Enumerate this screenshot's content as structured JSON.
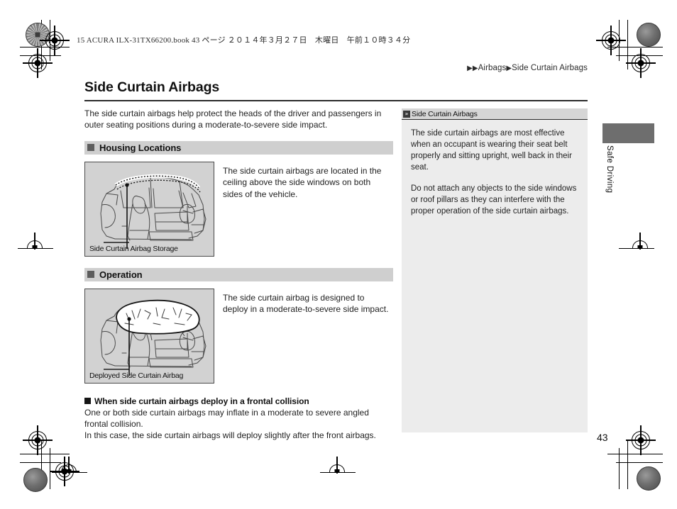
{
  "print_header": "15 ACURA ILX-31TX66200.book  43 ページ  ２０１４年３月２７日　木曜日　午前１０時３４分",
  "breadcrumb": {
    "arrow1": "▶",
    "arrow2": "▶",
    "parent": "Airbags",
    "arrow3": "▶",
    "current": "Side Curtain Airbags"
  },
  "page": {
    "title": "Side Curtain Airbags",
    "intro": "The side curtain airbags help protect the heads of the driver and passengers in outer seating positions during a moderate-to-severe side impact.",
    "number": "43"
  },
  "sections": [
    {
      "heading": "Housing Locations",
      "figure_caption": "Side Curtain Airbag Storage",
      "body": "The side curtain airbags are located in the ceiling above the side windows on both sides of the vehicle."
    },
    {
      "heading": "Operation",
      "figure_caption": "Deployed Side Curtain Airbag",
      "body": "The side curtain airbag is designed to deploy in a moderate-to-severe side impact."
    }
  ],
  "subsection": {
    "heading": "When side curtain airbags deploy in a frontal collision",
    "paragraph1": "One or both side curtain airbags may inflate in a moderate to severe angled frontal collision.",
    "paragraph2": "In this case, the side curtain airbags will deploy slightly after the front airbags."
  },
  "sidepanel": {
    "icon": "double-chevron-icon",
    "title": "Side Curtain Airbags",
    "paragraph1": "The side curtain airbags are most effective when an occupant is wearing their seat belt properly and sitting upright, well back in their seat.",
    "paragraph2": "Do not attach any objects to the side windows or roof pillars as they can interfere with the proper operation of the side curtain airbags."
  },
  "edge_tab": {
    "label": "Safe Driving"
  },
  "colors": {
    "section_bar": "#cfcfcf",
    "figure_bg": "#d2d2d2",
    "sidepanel_bg": "#ececec",
    "tab_block": "#6e6e6e"
  }
}
